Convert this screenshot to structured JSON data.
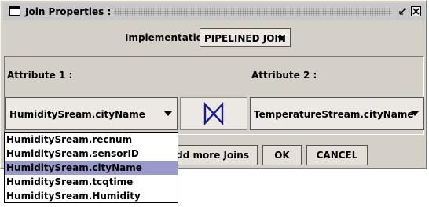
{
  "window": {
    "title": "Join Properties :"
  },
  "implementation": {
    "label": "Implementation:",
    "selected": "PIPELINED JOIN"
  },
  "attributes": {
    "attr1_label": "Attribute 1 :",
    "attr2_label": "Attribute 2 :",
    "attr1_value": "HumiditySream.cityName",
    "attr2_value": "TemperatureStream.cityName"
  },
  "join_operator": {
    "icon": "bowtie-join-icon",
    "color": "#1a1a8c"
  },
  "buttons": {
    "add_more": "Add more Joins",
    "ok": "OK",
    "cancel": "CANCEL"
  },
  "dropdown_options": [
    "HumiditySream.recnum",
    "HumiditySream.sensorID",
    "HumiditySream.cityName",
    "HumiditySream.tcqtime",
    "HumiditySream.Humidity"
  ],
  "dropdown_selected_index": 2,
  "colors": {
    "dialog_bg": "#d4d0c8",
    "selection_bg": "#9999cc"
  }
}
